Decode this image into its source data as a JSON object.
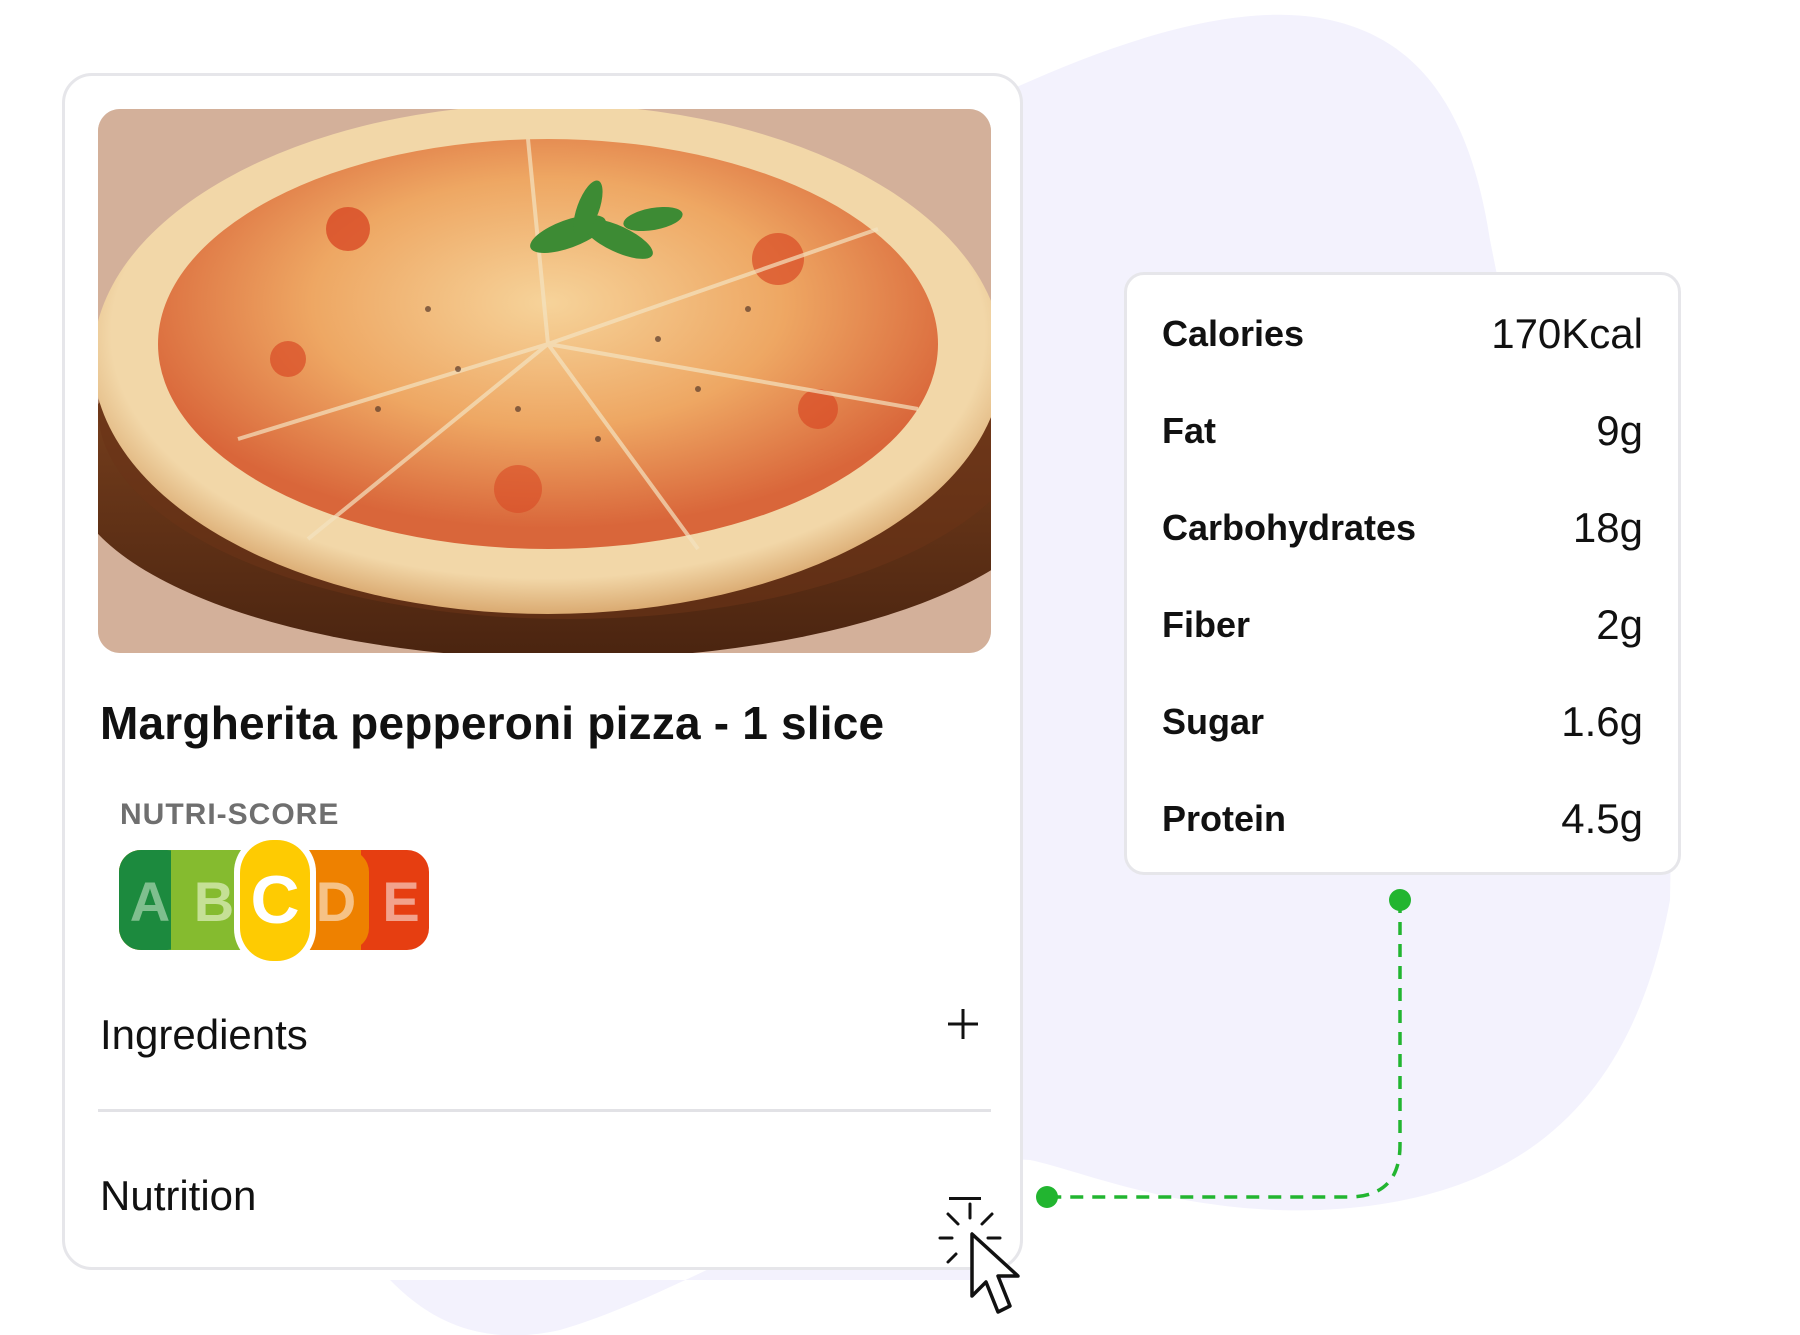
{
  "product": {
    "title": "Margherita pepperoni pizza - 1 slice",
    "image_alt": "pizza photo"
  },
  "nutri_score": {
    "label": "NUTRI-SCORE",
    "grades": [
      "A",
      "B",
      "C",
      "D",
      "E"
    ],
    "selected": "C",
    "colors": [
      "#1c8a3e",
      "#85bb2f",
      "#fecb02",
      "#ee8100",
      "#e63e11"
    ]
  },
  "sections": {
    "ingredients": {
      "label": "Ingredients",
      "icon": "plus-icon"
    },
    "nutrition": {
      "label": "Nutrition",
      "icon": "minus-icon"
    }
  },
  "nutrition_facts": [
    {
      "name": "Calories",
      "value": "170Kcal"
    },
    {
      "name": "Fat",
      "value": "9g"
    },
    {
      "name": "Carbohydrates",
      "value": "18g"
    },
    {
      "name": "Fiber",
      "value": "2g"
    },
    {
      "name": "Sugar",
      "value": "1.6g"
    },
    {
      "name": "Protein",
      "value": "4.5g"
    }
  ],
  "colors": {
    "connector": "#22b530",
    "blob": "#f3f2fd",
    "border": "#e6e6ea"
  }
}
